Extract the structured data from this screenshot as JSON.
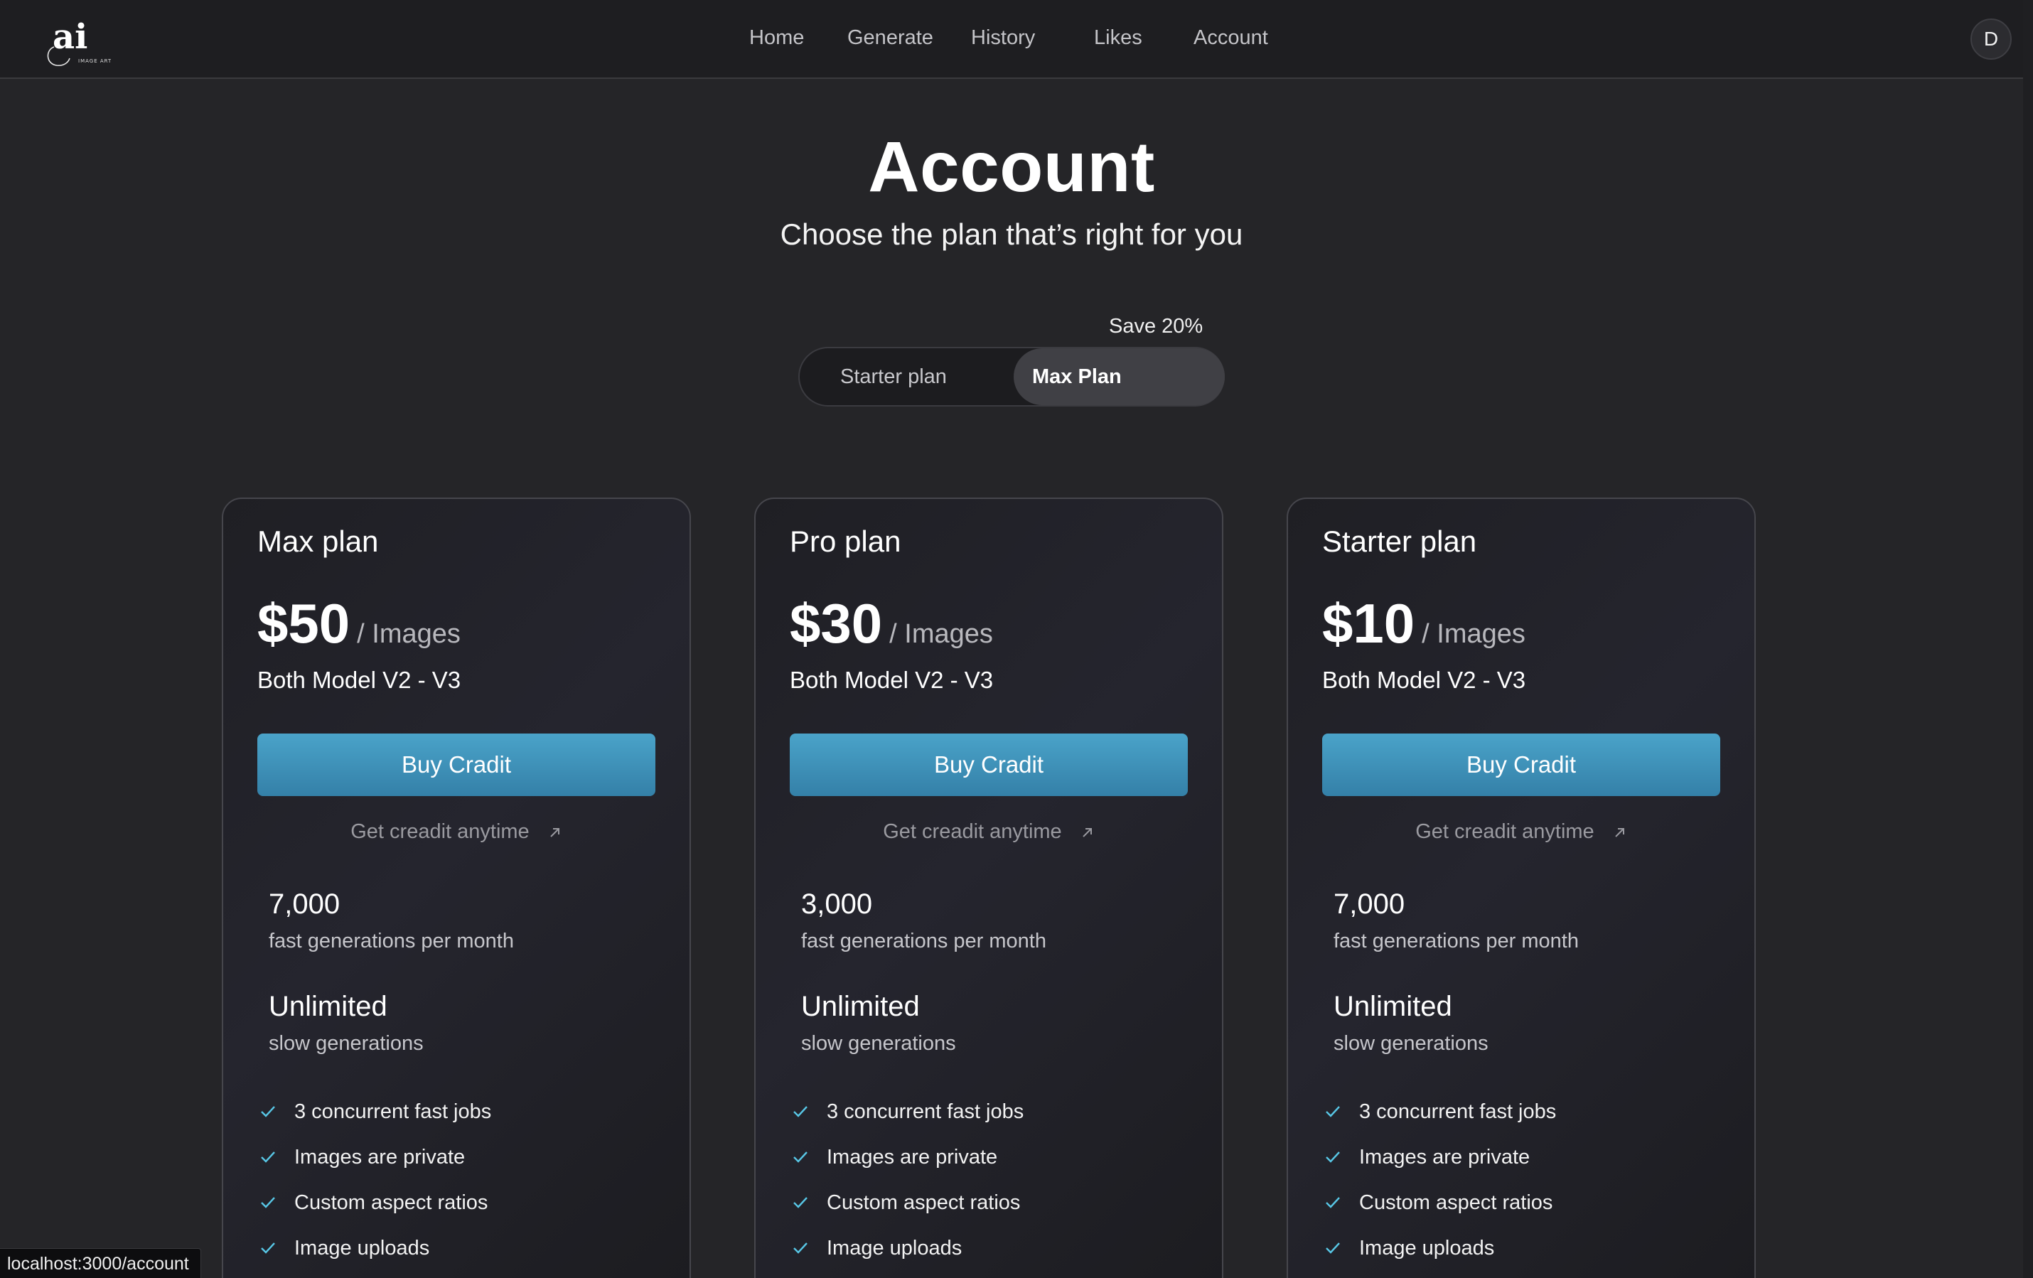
{
  "nav": {
    "logo_text": "ai",
    "logo_subtext": "IMAGE ART",
    "links": [
      "Home",
      "Generate",
      "History",
      "Likes",
      "Account"
    ],
    "avatar_initial": "D"
  },
  "header": {
    "title": "Account",
    "subtitle": "Choose the plan that’s right for you"
  },
  "toggle": {
    "badge": "Save 20%",
    "options": [
      "Starter plan",
      "Max Plan"
    ],
    "selected": "Max Plan"
  },
  "plans": [
    {
      "name": "Max plan",
      "price": "$50",
      "unit": "/ Images",
      "model": "Both Model V2 - V3",
      "button": "Buy Cradit",
      "link": "Get creadit anytime",
      "stat1_value": "7,000",
      "stat1_label": "fast generations per month",
      "stat2_value": "Unlimited",
      "stat2_label": "slow generations",
      "features": [
        "3 concurrent fast jobs",
        "Images are private",
        "Custom aspect ratios",
        "Image uploads"
      ]
    },
    {
      "name": "Pro plan",
      "price": "$30",
      "unit": "/ Images",
      "model": "Both Model V2 - V3",
      "button": "Buy Cradit",
      "link": "Get creadit anytime",
      "stat1_value": "3,000",
      "stat1_label": "fast generations per month",
      "stat2_value": "Unlimited",
      "stat2_label": "slow generations",
      "features": [
        "3 concurrent fast jobs",
        "Images are private",
        "Custom aspect ratios",
        "Image uploads"
      ]
    },
    {
      "name": "Starter plan",
      "price": "$10",
      "unit": "/ Images",
      "model": "Both Model V2 - V3",
      "button": "Buy Cradit",
      "link": "Get creadit anytime",
      "stat1_value": "7,000",
      "stat1_label": "fast generations per month",
      "stat2_value": "Unlimited",
      "stat2_label": "slow generations",
      "features": [
        "3 concurrent fast jobs",
        "Images are private",
        "Custom aspect ratios",
        "Image uploads"
      ]
    }
  ],
  "status_bar": {
    "url": "localhost:3000/account"
  },
  "colors": {
    "background": "#252528",
    "topbar": "#1e1e21",
    "button": "#3f93bd",
    "check": "#58c7e6"
  }
}
